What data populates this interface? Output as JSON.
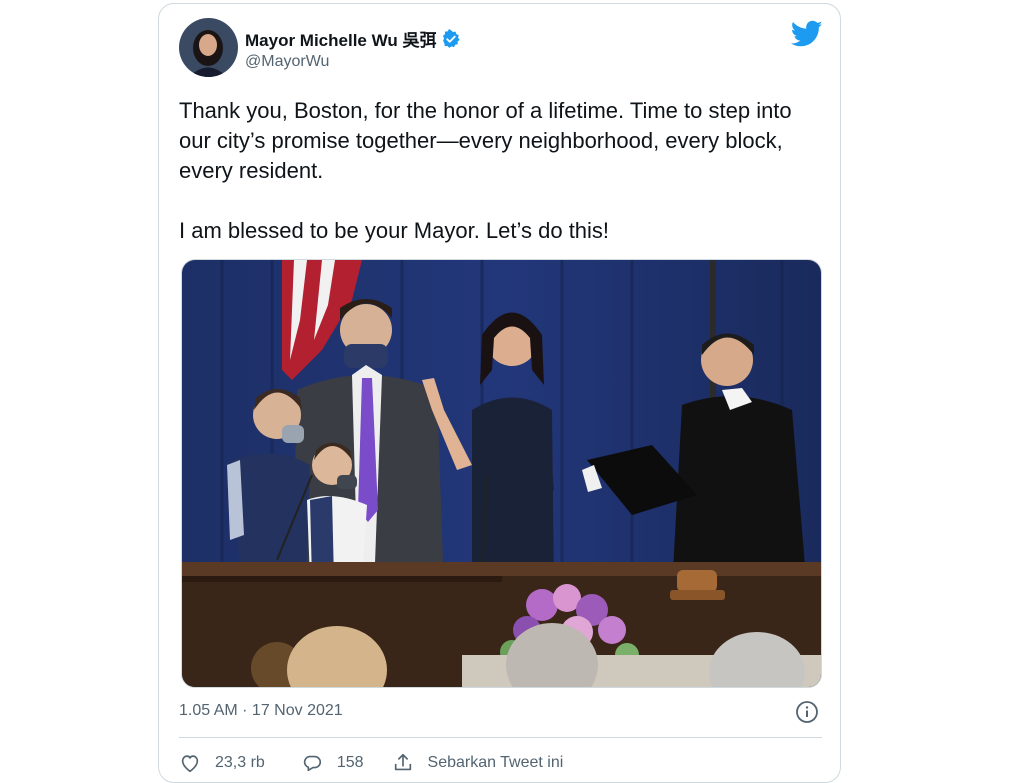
{
  "tweet": {
    "author_name": "Mayor Michelle Wu 吳弭",
    "author_handle": "@MayorWu",
    "verified": true,
    "text_paragraph_1": "Thank you, Boston, for the honor of a lifetime. Time to step into our city’s promise together—every neighborhood, every block, every resident.",
    "text_paragraph_2": "I am blessed to be your Mayor. Let’s do this!",
    "timestamp": "1.05 AM · 17 Nov 2021"
  },
  "actions": {
    "like_count": "23,3 rb",
    "reply_count": "158",
    "share_label": "Sebarkan Tweet ini"
  },
  "icons": {
    "brand": "twitter-bird-icon",
    "verified": "verified-badge-icon",
    "info": "info-icon",
    "like": "heart-icon",
    "reply": "reply-bubble-icon",
    "share": "share-upload-icon"
  },
  "colors": {
    "brand_blue": "#1d9bf0",
    "text_primary": "#0f1419",
    "text_secondary": "#536471",
    "border": "#cfd9de"
  }
}
